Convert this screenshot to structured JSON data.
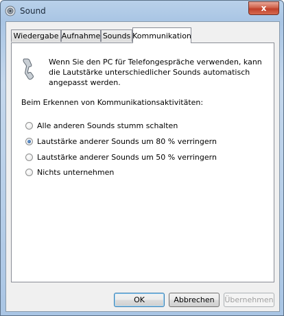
{
  "window": {
    "title": "Sound",
    "close_glyph": "x"
  },
  "tabs": [
    {
      "label": "Wiedergabe"
    },
    {
      "label": "Aufnahme"
    },
    {
      "label": "Sounds"
    },
    {
      "label": "Kommunikation",
      "active": true
    }
  ],
  "panel": {
    "icon": "telephone-handset-icon",
    "info_text": "Wenn Sie den PC für Telefongespräche verwenden, kann die Lautstärke unterschiedlicher Sounds automatisch angepasst werden.",
    "heading": "Beim Erkennen von Kommunikationsaktivitäten:",
    "options": [
      {
        "label": "Alle anderen Sounds stumm schalten",
        "checked": false
      },
      {
        "label": "Lautstärke anderer Sounds um 80 % verringern",
        "checked": true
      },
      {
        "label": "Lautstärke anderer Sounds um 50 % verringern",
        "checked": false
      },
      {
        "label": "Nichts unternehmen",
        "checked": false
      }
    ]
  },
  "buttons": {
    "ok": "OK",
    "cancel": "Abbrechen",
    "apply": "Übernehmen"
  }
}
